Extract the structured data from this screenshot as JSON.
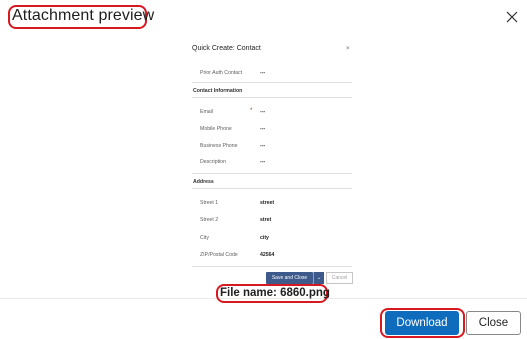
{
  "dialog": {
    "title": "Attachment preview",
    "file_name": "File name: 6860.png",
    "download_label": "Download",
    "close_label": "Close"
  },
  "preview": {
    "title": "Quick Create: Contact",
    "close_glyph": "×",
    "prior_auth": {
      "label": "Prior Auth Contact",
      "value": "---"
    },
    "contact_section": "Contact Information",
    "contact_fields": [
      {
        "label": "Email",
        "value": "---",
        "required": "*"
      },
      {
        "label": "Mobile Phone",
        "value": "---"
      },
      {
        "label": "Business Phone",
        "value": "---"
      },
      {
        "label": "Description",
        "value": "---"
      }
    ],
    "address_section": "Address",
    "address_fields": [
      {
        "label": "Street 1",
        "value": "street"
      },
      {
        "label": "Street 2",
        "value": "stret"
      },
      {
        "label": "City",
        "value": "city"
      },
      {
        "label": "ZIP/Postal Code",
        "value": "42564"
      }
    ],
    "save_label": "Save and Close",
    "save_caret": "⌄",
    "cancel_label": "Cancel"
  },
  "colors": {
    "annotation": "#d71921",
    "primary": "#0f6cbd",
    "save_button": "#3d5a8a"
  }
}
